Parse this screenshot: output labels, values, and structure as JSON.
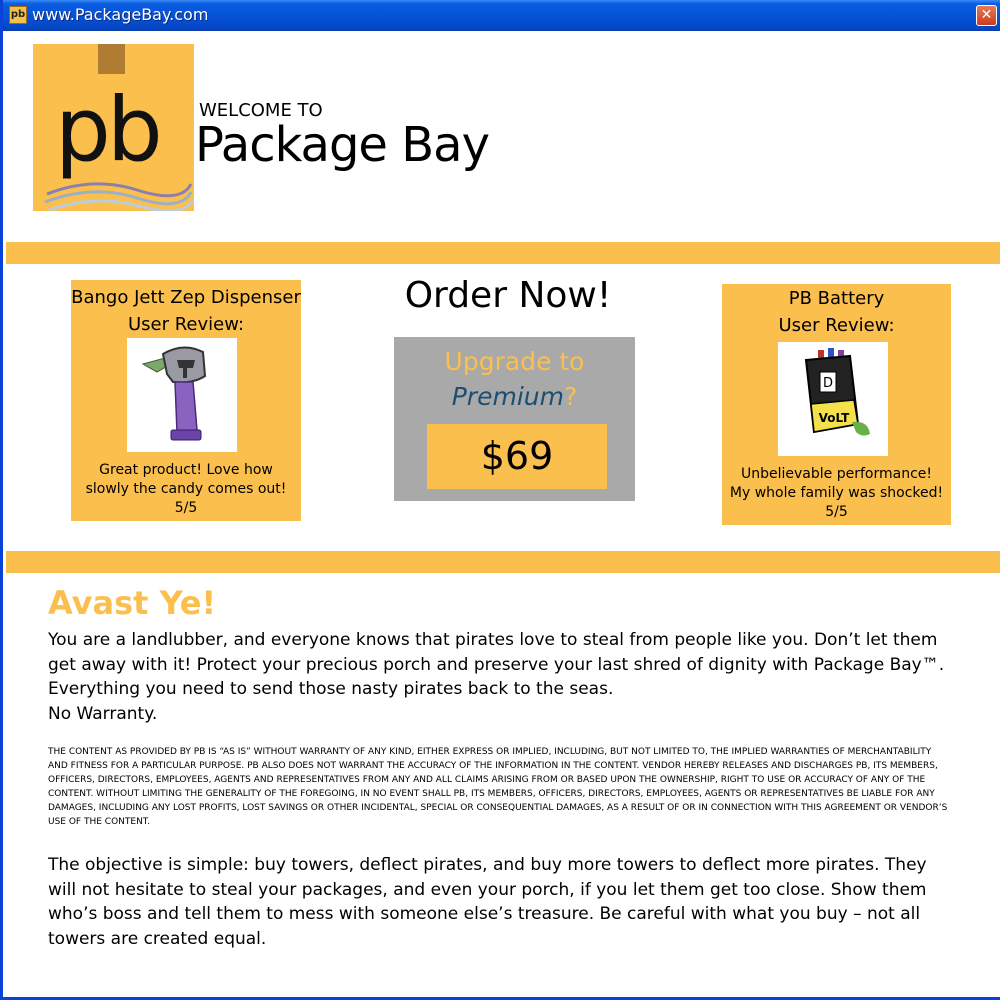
{
  "window": {
    "title": "www.PackageBay.com",
    "icon": "pb-app-icon",
    "icon_text": "pb",
    "close_glyph": "✕"
  },
  "header": {
    "logo_text": "pb",
    "welcome": "WELCOME TO",
    "brand": "Package Bay"
  },
  "reviews": [
    {
      "product": "Bango Jett Zep Dispenser",
      "heading": "User Review:",
      "image": "helmet-candy-dispenser-drawing",
      "line1": "Great product! Love how",
      "line2": "slowly the candy comes out!",
      "rating": "5/5"
    },
    {
      "product": "PB Battery",
      "heading": "User Review:",
      "image": "volt-battery-drawing",
      "battery_label": "VoLT",
      "battery_letter": "D",
      "line1": "Unbelievable performance!",
      "line2": "My whole family was shocked!",
      "rating": "5/5"
    }
  ],
  "order": {
    "title": "Order Now!",
    "upgrade_line": "Upgrade to",
    "premium_word": "Premium",
    "question_mark": "?",
    "price": "$69"
  },
  "body": {
    "heading": "Avast Ye!",
    "intro": "You are a landlubber, and everyone knows that pirates love to steal from people like you. Don’t let them get away with it! Protect your precious porch and preserve your last shred of dignity with Package Bay™. Everything you need to send those nasty pirates back to the seas.",
    "no_warranty": "No Warranty.",
    "legal": "THE CONTENT AS PROVIDED BY PB IS “AS IS” WITHOUT WARRANTY OF ANY KIND, EITHER EXPRESS OR IMPLIED, INCLUDING, BUT NOT LIMITED TO, THE IMPLIED WARRANTIES OF MERCHANTABILITY AND FITNESS FOR A PARTICULAR PURPOSE. PB ALSO DOES NOT WARRANT THE ACCURACY OF THE INFORMATION IN THE CONTENT. VENDOR HEREBY RELEASES AND DISCHARGES PB, ITS MEMBERS, OFFICERS, DIRECTORS, EMPLOYEES, AGENTS AND REPRESENTATIVES FROM ANY AND ALL CLAIMS ARISING FROM OR BASED UPON THE OWNERSHIP, RIGHT TO USE OR ACCURACY OF ANY OF THE CONTENT. WITHOUT LIMITING THE GENERALITY OF THE FOREGOING, IN NO EVENT SHALL PB, ITS MEMBERS, OFFICERS, DIRECTORS, EMPLOYEES, AGENTS OR REPRESENTATIVES BE LIABLE FOR ANY DAMAGES, INCLUDING ANY LOST PROFITS, LOST SAVINGS OR OTHER INCIDENTAL, SPECIAL OR CONSEQUENTIAL DAMAGES, AS A RESULT OF OR IN CONNECTION WITH THIS AGREEMENT OR VENDOR’S USE OF THE CONTENT.",
    "objective": "The objective is simple: buy towers, deflect pirates, and buy more towers to deflect more pirates. They will not hesitate to steal your packages, and even your porch, if you let them get too close. Show them who’s boss and tell them to mess with someone else’s treasure. Be careful with what you buy – not all towers are created equal."
  },
  "colors": {
    "accent": "#fbbf4e",
    "premium": "#1b4f72",
    "panel_gray": "#a9a9a9",
    "titlebar": "#0653d8"
  }
}
